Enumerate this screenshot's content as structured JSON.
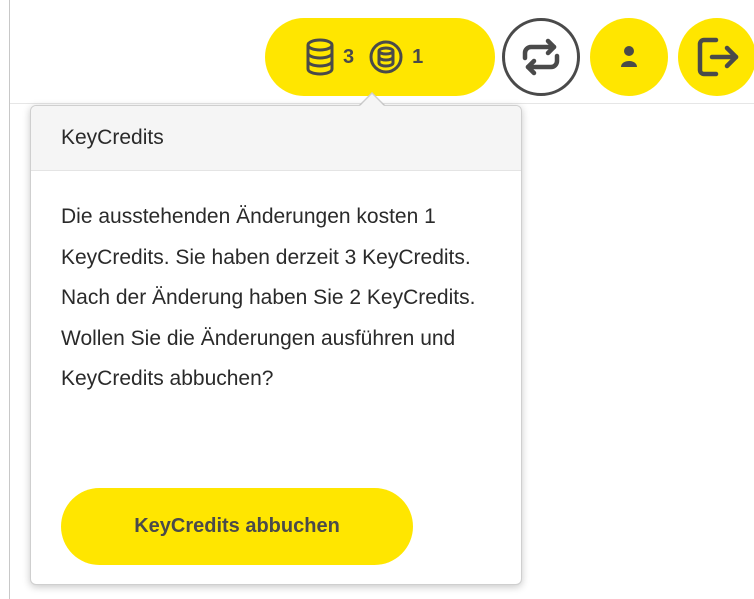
{
  "header": {
    "credits_available": "3",
    "credits_cost": "1"
  },
  "popover": {
    "title": "KeyCredits",
    "message": "Die ausstehenden Änderungen kosten 1 KeyCredits. Sie haben derzeit 3 KeyCredits. Nach der Änderung haben Sie 2 KeyCredits. Wollen Sie die Änderungen ausführen und KeyCredits abbuchen?",
    "confirm_label": "KeyCredits abbuchen"
  },
  "icons": {
    "credits_stack": "database-stack-icon",
    "credits_coin": "coin-icon",
    "sync": "sync-icon",
    "user": "user-icon",
    "logout": "logout-icon"
  },
  "colors": {
    "accent": "#ffe600",
    "text": "#4a4a4a"
  }
}
